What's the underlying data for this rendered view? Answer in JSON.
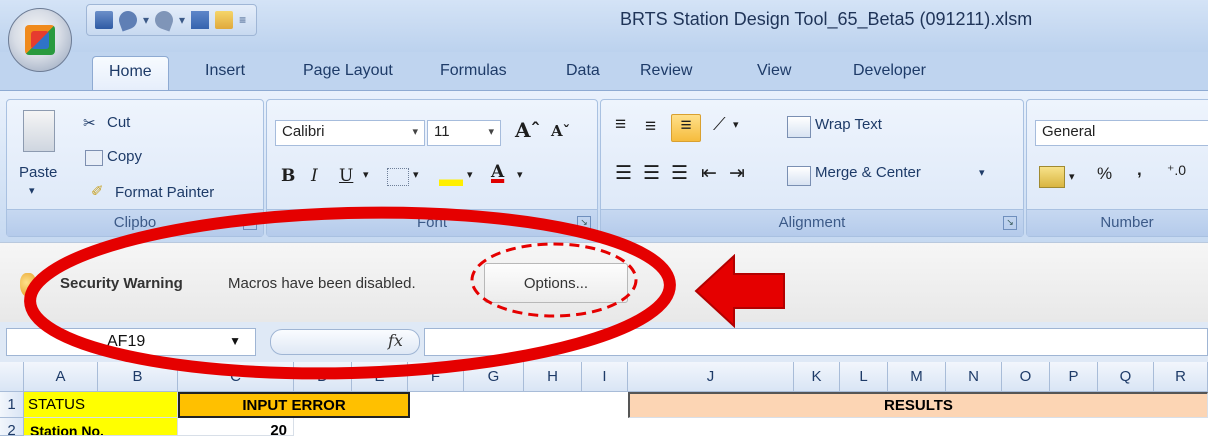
{
  "window": {
    "title": "BRTS Station Design Tool_65_Beta5 (091211).xlsm",
    "qat_customize": "≡"
  },
  "tabs": [
    "Home",
    "Insert",
    "Page Layout",
    "Formulas",
    "Data",
    "Review",
    "View",
    "Developer"
  ],
  "active_tab": "Home",
  "ribbon": {
    "clipboard": {
      "paste": "Paste",
      "cut": "Cut",
      "copy": "Copy",
      "format_painter": "Format Painter",
      "label": "Clipbo"
    },
    "font": {
      "name": "Calibri",
      "size": "11",
      "grow": "Aˆ",
      "shrink": "Aˇ",
      "bold": "B",
      "italic": "I",
      "underline": "U",
      "label": "Font"
    },
    "alignment": {
      "wrap_text": "Wrap Text",
      "merge_center": "Merge & Center",
      "label": "Alignment"
    },
    "number": {
      "format": "General",
      "percent": "%",
      "comma": ",",
      "label": "Number"
    }
  },
  "security": {
    "title": "Security Warning",
    "message": "Macros have been disabled.",
    "options_button": "Options..."
  },
  "formula_bar": {
    "name_box": "AF19",
    "fx": "fx"
  },
  "grid": {
    "columns": [
      "A",
      "B",
      "C",
      "D",
      "E",
      "F",
      "G",
      "H",
      "I",
      "J",
      "K",
      "L",
      "M",
      "N",
      "O",
      "P",
      "Q",
      "R"
    ],
    "rows": [
      {
        "num": "1",
        "a": "STATUS",
        "c": "INPUT ERROR",
        "results": "RESULTS"
      },
      {
        "num": "2",
        "a": "Station No.",
        "c": "20"
      }
    ]
  },
  "colors": {
    "status_fill": "#ffff00",
    "input_error_fill": "#ffc000",
    "results_fill": "#fcd5b4",
    "callout_red": "#e50000"
  }
}
